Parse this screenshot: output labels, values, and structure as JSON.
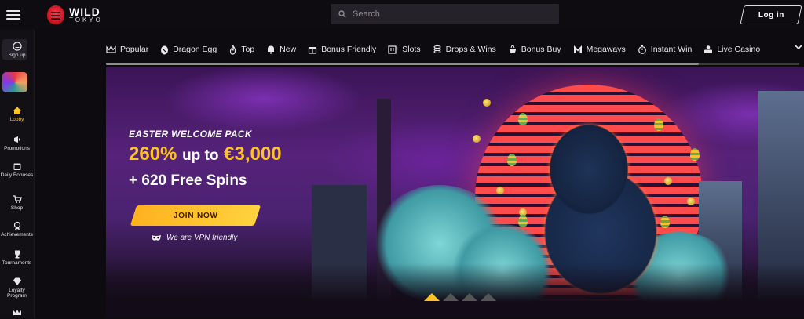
{
  "header": {
    "logo_word": "WILD",
    "logo_sub": "TOKYO",
    "search_placeholder": "Search",
    "login_label": "Log in"
  },
  "sidebar": {
    "items": [
      {
        "label": "Sign up",
        "icon": "signup-icon"
      },
      {
        "label": "Lobby",
        "icon": "home-icon",
        "active": true
      },
      {
        "label": "Promotions",
        "icon": "megaphone-icon"
      },
      {
        "label": "Daily Bonuses",
        "icon": "calendar-icon"
      },
      {
        "label": "Shop",
        "icon": "cart-icon"
      },
      {
        "label": "Achievements",
        "icon": "medal-icon"
      },
      {
        "label": "Tournaments",
        "icon": "trophy-icon"
      },
      {
        "label": "Loyalty Program",
        "icon": "diamond-icon"
      }
    ]
  },
  "categories": [
    {
      "label": "Popular",
      "icon": "crown-icon"
    },
    {
      "label": "Dragon Egg",
      "icon": "egg-icon"
    },
    {
      "label": "Top",
      "icon": "flame-icon"
    },
    {
      "label": "New",
      "icon": "bell-icon"
    },
    {
      "label": "Bonus Friendly",
      "icon": "gift-icon"
    },
    {
      "label": "Slots",
      "icon": "slot-machine-icon"
    },
    {
      "label": "Drops & Wins",
      "icon": "coins-icon"
    },
    {
      "label": "Bonus Buy",
      "icon": "bag-icon"
    },
    {
      "label": "Megaways",
      "icon": "m-icon"
    },
    {
      "label": "Instant Win",
      "icon": "stopwatch-icon"
    },
    {
      "label": "Live Casino",
      "icon": "dealer-icon"
    }
  ],
  "banner": {
    "eyebrow": "EASTER WELCOME PACK",
    "percent": "260%",
    "up_to": "up to",
    "amount": "€3,000",
    "spins": "+ 620 Free Spins",
    "cta": "JOIN NOW",
    "vpn_text": "We are VPN friendly",
    "slide_count": 4,
    "active_slide": 1
  },
  "colors": {
    "accent": "#ffc224",
    "cta_start": "#ffb11f",
    "cta_end": "#ffd23f",
    "background": "#0e0b10"
  }
}
